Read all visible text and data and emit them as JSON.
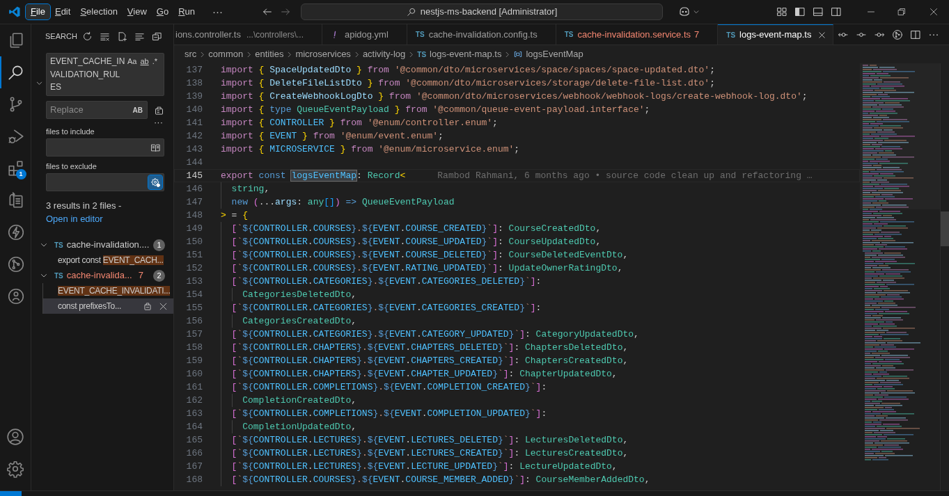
{
  "title_bar": {
    "menu": [
      {
        "label": "File",
        "selected": true
      },
      {
        "label": "Edit",
        "selected": false
      },
      {
        "label": "Selection",
        "selected": false
      },
      {
        "label": "View",
        "selected": false
      },
      {
        "label": "Go",
        "selected": false
      },
      {
        "label": "Run",
        "selected": false
      }
    ],
    "overflow": "···",
    "command_center": "nestjs-ms-backend [Administrator]"
  },
  "activity_bar": {
    "items": [
      {
        "kind": "files",
        "selected": false
      },
      {
        "kind": "search",
        "selected": true
      },
      {
        "kind": "source-control",
        "selected": false
      },
      {
        "kind": "debug",
        "selected": false
      },
      {
        "kind": "extensions",
        "selected": false,
        "badge": "1"
      },
      {
        "kind": "remote",
        "selected": false
      },
      {
        "kind": "lightning",
        "selected": false
      },
      {
        "kind": "git",
        "selected": false
      },
      {
        "kind": "circle",
        "selected": false
      }
    ],
    "bottom": [
      {
        "kind": "account"
      },
      {
        "kind": "settings"
      }
    ]
  },
  "search_panel": {
    "title": "SEARCH",
    "replace_expanded": true,
    "query": {
      "value": "EVENT_CACHE_INVALIDATION_RULES",
      "toggles": [
        {
          "label": "Aa",
          "selected": false
        },
        {
          "label": "ab",
          "selected": false
        },
        {
          "label": ".*",
          "selected": false
        }
      ]
    },
    "replace": {
      "placeholder": "Replace",
      "toggle": {
        "label": "AB",
        "selected": false
      }
    },
    "details_toggle": "···",
    "include": {
      "label": "files to include",
      "selected": false
    },
    "exclude": {
      "label": "files to exclude",
      "selected": true
    },
    "message": "3 results in 2 files - ",
    "link": "Open in editor",
    "results": [
      {
        "icon": "TS",
        "file": "cache-invalidation....",
        "error": false,
        "count": "1",
        "expanded": true,
        "matches": [
          {
            "before": "export const ",
            "match": "EVENT_CACH...",
            "selected": false
          }
        ]
      },
      {
        "icon": "TS",
        "file": "cache-invalida...",
        "error": true,
        "problems": "7",
        "count": "2",
        "expanded": true,
        "matches": [
          {
            "match": "EVENT_CACHE_INVALIDATI...",
            "selected": false
          },
          {
            "before": "const prefixesTo...",
            "selected": true
          }
        ]
      }
    ]
  },
  "tabs": [
    {
      "kind": "plain",
      "label": "ions.controller.ts",
      "description": "...\\controllers\\...",
      "error": false,
      "selected": false
    },
    {
      "kind": "yaml",
      "label": "apidog.yml",
      "error": false,
      "selected": false
    },
    {
      "kind": "ts",
      "icon": "TS",
      "label": "cache-invalidation.config.ts",
      "error": false,
      "selected": false
    },
    {
      "kind": "ts",
      "icon": "TS",
      "label": "cache-invalidation.service.ts",
      "problems": "7",
      "error": true,
      "selected": false
    },
    {
      "kind": "ts",
      "icon": "TS",
      "label": "logs-event-map.ts",
      "error": false,
      "selected": true
    }
  ],
  "breadcrumb": {
    "folders": [
      "src",
      "common",
      "entities",
      "microservices",
      "activity-log"
    ],
    "file": {
      "icon": "TS",
      "label": "logs-event-map.ts"
    },
    "symbol": "logsEventMap"
  },
  "editor": {
    "lines": [
      {
        "number": "137",
        "kind": "top",
        "current": false,
        "tokens": [
          {
            "kind": "keyword",
            "text": "import "
          },
          {
            "kind": "brace",
            "text": "{"
          },
          {
            "kind": "name",
            "text": " SpaceUpdatedDto "
          },
          {
            "kind": "brace",
            "text": "}"
          },
          {
            "kind": "keyword",
            "text": " from "
          },
          {
            "kind": "string",
            "text": "'@common/dto/microservices/space/spaces/space-updated.dto'"
          },
          {
            "kind": "plain",
            "text": ";"
          }
        ]
      },
      {
        "number": "138",
        "kind": "top",
        "current": false,
        "tokens": [
          {
            "kind": "keyword",
            "text": "import "
          },
          {
            "kind": "brace",
            "text": "{"
          },
          {
            "kind": "name",
            "text": " DeleteFileListDto "
          },
          {
            "kind": "brace",
            "text": "}"
          },
          {
            "kind": "keyword",
            "text": " from "
          },
          {
            "kind": "string",
            "text": "'@common/dto/microservices/storage/delete-file-list.dto'"
          },
          {
            "kind": "plain",
            "text": ";"
          }
        ]
      },
      {
        "number": "139",
        "kind": "top",
        "current": false,
        "tokens": [
          {
            "kind": "keyword",
            "text": "import "
          },
          {
            "kind": "brace",
            "text": "{"
          },
          {
            "kind": "name",
            "text": " CreateWebhookLogDto "
          },
          {
            "kind": "brace",
            "text": "}"
          },
          {
            "kind": "keyword",
            "text": " from "
          },
          {
            "kind": "string",
            "text": "'@common/dto/microservices/webhook/webhook-logs/create-webhook-log.dto'"
          },
          {
            "kind": "plain",
            "text": ";"
          }
        ]
      },
      {
        "number": "140",
        "kind": "top",
        "current": false,
        "tokens": [
          {
            "kind": "keyword",
            "text": "import "
          },
          {
            "kind": "brace",
            "text": "{"
          },
          {
            "kind": "storage",
            "text": " type"
          },
          {
            "kind": "type",
            "text": " QueueEventPayload "
          },
          {
            "kind": "brace",
            "text": "}"
          },
          {
            "kind": "keyword",
            "text": " from "
          },
          {
            "kind": "string",
            "text": "'@common/queue-event-payload.interface'"
          },
          {
            "kind": "plain",
            "text": ";"
          }
        ]
      },
      {
        "number": "141",
        "kind": "top",
        "current": false,
        "tokens": [
          {
            "kind": "keyword",
            "text": "import "
          },
          {
            "kind": "brace",
            "text": "{"
          },
          {
            "kind": "constant",
            "text": " CONTROLLER "
          },
          {
            "kind": "brace",
            "text": "}"
          },
          {
            "kind": "keyword",
            "text": " from "
          },
          {
            "kind": "string",
            "text": "'@enum/controller.enum'"
          },
          {
            "kind": "plain",
            "text": ";"
          }
        ]
      },
      {
        "number": "142",
        "kind": "top",
        "current": false,
        "tokens": [
          {
            "kind": "keyword",
            "text": "import "
          },
          {
            "kind": "brace",
            "text": "{"
          },
          {
            "kind": "constant",
            "text": " EVENT "
          },
          {
            "kind": "brace",
            "text": "}"
          },
          {
            "kind": "keyword",
            "text": " from "
          },
          {
            "kind": "string",
            "text": "'@enum/event.enum'"
          },
          {
            "kind": "plain",
            "text": ";"
          }
        ]
      },
      {
        "number": "143",
        "kind": "top",
        "current": false,
        "tokens": [
          {
            "kind": "keyword",
            "text": "import "
          },
          {
            "kind": "brace",
            "text": "{"
          },
          {
            "kind": "constant",
            "text": " MICROSERVICE "
          },
          {
            "kind": "brace",
            "text": "}"
          },
          {
            "kind": "keyword",
            "text": " from "
          },
          {
            "kind": "string",
            "text": "'@enum/microservice.enum'"
          },
          {
            "kind": "plain",
            "text": ";"
          }
        ]
      },
      {
        "number": "144",
        "kind": "top",
        "current": false
      },
      {
        "number": "145",
        "kind": "top",
        "current": true,
        "tokens": [
          {
            "kind": "keyword",
            "text": "export "
          },
          {
            "kind": "storage",
            "text": "const "
          },
          {
            "kind": "symbol",
            "text": "logsEventMap"
          },
          {
            "kind": "plain",
            "text": ": "
          },
          {
            "kind": "type",
            "text": "Record"
          },
          {
            "kind": "brace",
            "text": "<"
          }
        ],
        "blame": "Rambod Rahmani, 6 months ago • source code clean up and refactoring …"
      },
      {
        "number": "146",
        "kind": "member",
        "current": false,
        "tokens": [
          {
            "kind": "type",
            "text": "string"
          },
          {
            "kind": "plain",
            "text": ","
          }
        ]
      },
      {
        "number": "147",
        "kind": "member",
        "current": false,
        "tokens": [
          {
            "kind": "storage",
            "text": "new "
          },
          {
            "kind": "paren",
            "text": "("
          },
          {
            "kind": "plain",
            "text": "..."
          },
          {
            "kind": "name",
            "text": "args"
          },
          {
            "kind": "plain",
            "text": ": "
          },
          {
            "kind": "type",
            "text": "any"
          },
          {
            "kind": "bracket",
            "text": "[]"
          },
          {
            "kind": "paren",
            "text": ")"
          },
          {
            "kind": "storage",
            "text": " =>"
          },
          {
            "kind": "type",
            "text": " QueueEventPayload"
          }
        ]
      },
      {
        "number": "148",
        "kind": "top",
        "current": false,
        "tokens": [
          {
            "kind": "brace",
            "text": ">"
          },
          {
            "kind": "plain",
            "text": " = "
          },
          {
            "kind": "brace",
            "text": "{"
          }
        ]
      },
      {
        "number": "149",
        "kind": "member",
        "current": false,
        "tokens": [
          {
            "kind": "paren",
            "text": "["
          },
          {
            "kind": "string",
            "text": "`"
          },
          {
            "kind": "interp",
            "text": "${"
          },
          {
            "kind": "constant",
            "text": "CONTROLLER"
          },
          {
            "kind": "plain",
            "text": "."
          },
          {
            "kind": "constant",
            "text": "COURSES"
          },
          {
            "kind": "interp",
            "text": "}"
          },
          {
            "kind": "string",
            "text": "."
          },
          {
            "kind": "interp",
            "text": "${"
          },
          {
            "kind": "constant",
            "text": "EVENT"
          },
          {
            "kind": "plain",
            "text": "."
          },
          {
            "kind": "constant",
            "text": "COURSE_CREATED"
          },
          {
            "kind": "interp",
            "text": "}"
          },
          {
            "kind": "string",
            "text": "`"
          },
          {
            "kind": "paren",
            "text": "]"
          },
          {
            "kind": "plain",
            "text": ": "
          },
          {
            "kind": "type",
            "text": "CourseCreatedDto"
          },
          {
            "kind": "plain",
            "text": ","
          }
        ]
      },
      {
        "number": "150",
        "kind": "member",
        "current": false,
        "tokens": [
          {
            "kind": "paren",
            "text": "["
          },
          {
            "kind": "string",
            "text": "`"
          },
          {
            "kind": "interp",
            "text": "${"
          },
          {
            "kind": "constant",
            "text": "CONTROLLER"
          },
          {
            "kind": "plain",
            "text": "."
          },
          {
            "kind": "constant",
            "text": "COURSES"
          },
          {
            "kind": "interp",
            "text": "}"
          },
          {
            "kind": "string",
            "text": "."
          },
          {
            "kind": "interp",
            "text": "${"
          },
          {
            "kind": "constant",
            "text": "EVENT"
          },
          {
            "kind": "plain",
            "text": "."
          },
          {
            "kind": "constant",
            "text": "COURSE_UPDATED"
          },
          {
            "kind": "interp",
            "text": "}"
          },
          {
            "kind": "string",
            "text": "`"
          },
          {
            "kind": "paren",
            "text": "]"
          },
          {
            "kind": "plain",
            "text": ": "
          },
          {
            "kind": "type",
            "text": "CourseUpdatedDto"
          },
          {
            "kind": "plain",
            "text": ","
          }
        ]
      },
      {
        "number": "151",
        "kind": "member",
        "current": false,
        "tokens": [
          {
            "kind": "paren",
            "text": "["
          },
          {
            "kind": "string",
            "text": "`"
          },
          {
            "kind": "interp",
            "text": "${"
          },
          {
            "kind": "constant",
            "text": "CONTROLLER"
          },
          {
            "kind": "plain",
            "text": "."
          },
          {
            "kind": "constant",
            "text": "COURSES"
          },
          {
            "kind": "interp",
            "text": "}"
          },
          {
            "kind": "string",
            "text": "."
          },
          {
            "kind": "interp",
            "text": "${"
          },
          {
            "kind": "constant",
            "text": "EVENT"
          },
          {
            "kind": "plain",
            "text": "."
          },
          {
            "kind": "constant",
            "text": "COURSE_DELETED"
          },
          {
            "kind": "interp",
            "text": "}"
          },
          {
            "kind": "string",
            "text": "`"
          },
          {
            "kind": "paren",
            "text": "]"
          },
          {
            "kind": "plain",
            "text": ": "
          },
          {
            "kind": "type",
            "text": "CourseDeletedEventDto"
          },
          {
            "kind": "plain",
            "text": ","
          }
        ]
      },
      {
        "number": "152",
        "kind": "member",
        "current": false,
        "tokens": [
          {
            "kind": "paren",
            "text": "["
          },
          {
            "kind": "string",
            "text": "`"
          },
          {
            "kind": "interp",
            "text": "${"
          },
          {
            "kind": "constant",
            "text": "CONTROLLER"
          },
          {
            "kind": "plain",
            "text": "."
          },
          {
            "kind": "constant",
            "text": "COURSES"
          },
          {
            "kind": "interp",
            "text": "}"
          },
          {
            "kind": "string",
            "text": "."
          },
          {
            "kind": "interp",
            "text": "${"
          },
          {
            "kind": "constant",
            "text": "EVENT"
          },
          {
            "kind": "plain",
            "text": "."
          },
          {
            "kind": "constant",
            "text": "RATING_UPDATED"
          },
          {
            "kind": "interp",
            "text": "}"
          },
          {
            "kind": "string",
            "text": "`"
          },
          {
            "kind": "paren",
            "text": "]"
          },
          {
            "kind": "plain",
            "text": ": "
          },
          {
            "kind": "type",
            "text": "UpdateOwnerRatingDto"
          },
          {
            "kind": "plain",
            "text": ","
          }
        ]
      },
      {
        "number": "153",
        "kind": "member",
        "current": false,
        "tokens": [
          {
            "kind": "paren",
            "text": "["
          },
          {
            "kind": "string",
            "text": "`"
          },
          {
            "kind": "interp",
            "text": "${"
          },
          {
            "kind": "constant",
            "text": "CONTROLLER"
          },
          {
            "kind": "plain",
            "text": "."
          },
          {
            "kind": "constant",
            "text": "CATEGORIES"
          },
          {
            "kind": "interp",
            "text": "}"
          },
          {
            "kind": "string",
            "text": "."
          },
          {
            "kind": "interp",
            "text": "${"
          },
          {
            "kind": "constant",
            "text": "EVENT"
          },
          {
            "kind": "plain",
            "text": "."
          },
          {
            "kind": "constant",
            "text": "CATEGORIES_DELETED"
          },
          {
            "kind": "interp",
            "text": "}"
          },
          {
            "kind": "string",
            "text": "`"
          },
          {
            "kind": "paren",
            "text": "]"
          },
          {
            "kind": "plain",
            "text": ":"
          }
        ]
      },
      {
        "number": "154",
        "kind": "wrap",
        "current": false,
        "tokens": [
          {
            "kind": "type",
            "text": "CategoriesDeletedDto"
          },
          {
            "kind": "plain",
            "text": ","
          }
        ]
      },
      {
        "number": "155",
        "kind": "member",
        "current": false,
        "tokens": [
          {
            "kind": "paren",
            "text": "["
          },
          {
            "kind": "string",
            "text": "`"
          },
          {
            "kind": "interp",
            "text": "${"
          },
          {
            "kind": "constant",
            "text": "CONTROLLER"
          },
          {
            "kind": "plain",
            "text": "."
          },
          {
            "kind": "constant",
            "text": "CATEGORIES"
          },
          {
            "kind": "interp",
            "text": "}"
          },
          {
            "kind": "string",
            "text": "."
          },
          {
            "kind": "interp",
            "text": "${"
          },
          {
            "kind": "constant",
            "text": "EVENT"
          },
          {
            "kind": "plain",
            "text": "."
          },
          {
            "kind": "constant",
            "text": "CATEGORIES_CREATED"
          },
          {
            "kind": "interp",
            "text": "}"
          },
          {
            "kind": "string",
            "text": "`"
          },
          {
            "kind": "paren",
            "text": "]"
          },
          {
            "kind": "plain",
            "text": ":"
          }
        ]
      },
      {
        "number": "156",
        "kind": "wrap",
        "current": false,
        "tokens": [
          {
            "kind": "type",
            "text": "CategoriesCreatedDto"
          },
          {
            "kind": "plain",
            "text": ","
          }
        ]
      },
      {
        "number": "157",
        "kind": "member",
        "current": false,
        "tokens": [
          {
            "kind": "paren",
            "text": "["
          },
          {
            "kind": "string",
            "text": "`"
          },
          {
            "kind": "interp",
            "text": "${"
          },
          {
            "kind": "constant",
            "text": "CONTROLLER"
          },
          {
            "kind": "plain",
            "text": "."
          },
          {
            "kind": "constant",
            "text": "CATEGORIES"
          },
          {
            "kind": "interp",
            "text": "}"
          },
          {
            "kind": "string",
            "text": "."
          },
          {
            "kind": "interp",
            "text": "${"
          },
          {
            "kind": "constant",
            "text": "EVENT"
          },
          {
            "kind": "plain",
            "text": "."
          },
          {
            "kind": "constant",
            "text": "CATEGORY_UPDATED"
          },
          {
            "kind": "interp",
            "text": "}"
          },
          {
            "kind": "string",
            "text": "`"
          },
          {
            "kind": "paren",
            "text": "]"
          },
          {
            "kind": "plain",
            "text": ": "
          },
          {
            "kind": "type",
            "text": "CategoryUpdatedDto"
          },
          {
            "kind": "plain",
            "text": ","
          }
        ]
      },
      {
        "number": "158",
        "kind": "member",
        "current": false,
        "tokens": [
          {
            "kind": "paren",
            "text": "["
          },
          {
            "kind": "string",
            "text": "`"
          },
          {
            "kind": "interp",
            "text": "${"
          },
          {
            "kind": "constant",
            "text": "CONTROLLER"
          },
          {
            "kind": "plain",
            "text": "."
          },
          {
            "kind": "constant",
            "text": "CHAPTERS"
          },
          {
            "kind": "interp",
            "text": "}"
          },
          {
            "kind": "string",
            "text": "."
          },
          {
            "kind": "interp",
            "text": "${"
          },
          {
            "kind": "constant",
            "text": "EVENT"
          },
          {
            "kind": "plain",
            "text": "."
          },
          {
            "kind": "constant",
            "text": "CHAPTERS_DELETED"
          },
          {
            "kind": "interp",
            "text": "}"
          },
          {
            "kind": "string",
            "text": "`"
          },
          {
            "kind": "paren",
            "text": "]"
          },
          {
            "kind": "plain",
            "text": ": "
          },
          {
            "kind": "type",
            "text": "ChaptersDeletedDto"
          },
          {
            "kind": "plain",
            "text": ","
          }
        ]
      },
      {
        "number": "159",
        "kind": "member",
        "current": false,
        "tokens": [
          {
            "kind": "paren",
            "text": "["
          },
          {
            "kind": "string",
            "text": "`"
          },
          {
            "kind": "interp",
            "text": "${"
          },
          {
            "kind": "constant",
            "text": "CONTROLLER"
          },
          {
            "kind": "plain",
            "text": "."
          },
          {
            "kind": "constant",
            "text": "CHAPTERS"
          },
          {
            "kind": "interp",
            "text": "}"
          },
          {
            "kind": "string",
            "text": "."
          },
          {
            "kind": "interp",
            "text": "${"
          },
          {
            "kind": "constant",
            "text": "EVENT"
          },
          {
            "kind": "plain",
            "text": "."
          },
          {
            "kind": "constant",
            "text": "CHAPTERS_CREATED"
          },
          {
            "kind": "interp",
            "text": "}"
          },
          {
            "kind": "string",
            "text": "`"
          },
          {
            "kind": "paren",
            "text": "]"
          },
          {
            "kind": "plain",
            "text": ": "
          },
          {
            "kind": "type",
            "text": "ChaptersCreatedDto"
          },
          {
            "kind": "plain",
            "text": ","
          }
        ]
      },
      {
        "number": "160",
        "kind": "member",
        "current": false,
        "tokens": [
          {
            "kind": "paren",
            "text": "["
          },
          {
            "kind": "string",
            "text": "`"
          },
          {
            "kind": "interp",
            "text": "${"
          },
          {
            "kind": "constant",
            "text": "CONTROLLER"
          },
          {
            "kind": "plain",
            "text": "."
          },
          {
            "kind": "constant",
            "text": "CHAPTERS"
          },
          {
            "kind": "interp",
            "text": "}"
          },
          {
            "kind": "string",
            "text": "."
          },
          {
            "kind": "interp",
            "text": "${"
          },
          {
            "kind": "constant",
            "text": "EVENT"
          },
          {
            "kind": "plain",
            "text": "."
          },
          {
            "kind": "constant",
            "text": "CHAPTER_UPDATED"
          },
          {
            "kind": "interp",
            "text": "}"
          },
          {
            "kind": "string",
            "text": "`"
          },
          {
            "kind": "paren",
            "text": "]"
          },
          {
            "kind": "plain",
            "text": ": "
          },
          {
            "kind": "type",
            "text": "ChapterUpdatedDto"
          },
          {
            "kind": "plain",
            "text": ","
          }
        ]
      },
      {
        "number": "161",
        "kind": "member",
        "current": false,
        "tokens": [
          {
            "kind": "paren",
            "text": "["
          },
          {
            "kind": "string",
            "text": "`"
          },
          {
            "kind": "interp",
            "text": "${"
          },
          {
            "kind": "constant",
            "text": "CONTROLLER"
          },
          {
            "kind": "plain",
            "text": "."
          },
          {
            "kind": "constant",
            "text": "COMPLETIONS"
          },
          {
            "kind": "interp",
            "text": "}"
          },
          {
            "kind": "string",
            "text": "."
          },
          {
            "kind": "interp",
            "text": "${"
          },
          {
            "kind": "constant",
            "text": "EVENT"
          },
          {
            "kind": "plain",
            "text": "."
          },
          {
            "kind": "constant",
            "text": "COMPLETION_CREATED"
          },
          {
            "kind": "interp",
            "text": "}"
          },
          {
            "kind": "string",
            "text": "`"
          },
          {
            "kind": "paren",
            "text": "]"
          },
          {
            "kind": "plain",
            "text": ":"
          }
        ]
      },
      {
        "number": "162",
        "kind": "wrap",
        "current": false,
        "tokens": [
          {
            "kind": "type",
            "text": "CompletionCreatedDto"
          },
          {
            "kind": "plain",
            "text": ","
          }
        ]
      },
      {
        "number": "163",
        "kind": "member",
        "current": false,
        "tokens": [
          {
            "kind": "paren",
            "text": "["
          },
          {
            "kind": "string",
            "text": "`"
          },
          {
            "kind": "interp",
            "text": "${"
          },
          {
            "kind": "constant",
            "text": "CONTROLLER"
          },
          {
            "kind": "plain",
            "text": "."
          },
          {
            "kind": "constant",
            "text": "COMPLETIONS"
          },
          {
            "kind": "interp",
            "text": "}"
          },
          {
            "kind": "string",
            "text": "."
          },
          {
            "kind": "interp",
            "text": "${"
          },
          {
            "kind": "constant",
            "text": "EVENT"
          },
          {
            "kind": "plain",
            "text": "."
          },
          {
            "kind": "constant",
            "text": "COMPLETION_UPDATED"
          },
          {
            "kind": "interp",
            "text": "}"
          },
          {
            "kind": "string",
            "text": "`"
          },
          {
            "kind": "paren",
            "text": "]"
          },
          {
            "kind": "plain",
            "text": ":"
          }
        ]
      },
      {
        "number": "164",
        "kind": "wrap",
        "current": false,
        "tokens": [
          {
            "kind": "type",
            "text": "CompletionUpdatedDto"
          },
          {
            "kind": "plain",
            "text": ","
          }
        ]
      },
      {
        "number": "165",
        "kind": "member",
        "current": false,
        "tokens": [
          {
            "kind": "paren",
            "text": "["
          },
          {
            "kind": "string",
            "text": "`"
          },
          {
            "kind": "interp",
            "text": "${"
          },
          {
            "kind": "constant",
            "text": "CONTROLLER"
          },
          {
            "kind": "plain",
            "text": "."
          },
          {
            "kind": "constant",
            "text": "LECTURES"
          },
          {
            "kind": "interp",
            "text": "}"
          },
          {
            "kind": "string",
            "text": "."
          },
          {
            "kind": "interp",
            "text": "${"
          },
          {
            "kind": "constant",
            "text": "EVENT"
          },
          {
            "kind": "plain",
            "text": "."
          },
          {
            "kind": "constant",
            "text": "LECTURES_DELETED"
          },
          {
            "kind": "interp",
            "text": "}"
          },
          {
            "kind": "string",
            "text": "`"
          },
          {
            "kind": "paren",
            "text": "]"
          },
          {
            "kind": "plain",
            "text": ": "
          },
          {
            "kind": "type",
            "text": "LecturesDeletedDto"
          },
          {
            "kind": "plain",
            "text": ","
          }
        ]
      },
      {
        "number": "166",
        "kind": "member",
        "current": false,
        "tokens": [
          {
            "kind": "paren",
            "text": "["
          },
          {
            "kind": "string",
            "text": "`"
          },
          {
            "kind": "interp",
            "text": "${"
          },
          {
            "kind": "constant",
            "text": "CONTROLLER"
          },
          {
            "kind": "plain",
            "text": "."
          },
          {
            "kind": "constant",
            "text": "LECTURES"
          },
          {
            "kind": "interp",
            "text": "}"
          },
          {
            "kind": "string",
            "text": "."
          },
          {
            "kind": "interp",
            "text": "${"
          },
          {
            "kind": "constant",
            "text": "EVENT"
          },
          {
            "kind": "plain",
            "text": "."
          },
          {
            "kind": "constant",
            "text": "LECTURES_CREATED"
          },
          {
            "kind": "interp",
            "text": "}"
          },
          {
            "kind": "string",
            "text": "`"
          },
          {
            "kind": "paren",
            "text": "]"
          },
          {
            "kind": "plain",
            "text": ": "
          },
          {
            "kind": "type",
            "text": "LecturesCreatedDto"
          },
          {
            "kind": "plain",
            "text": ","
          }
        ]
      },
      {
        "number": "167",
        "kind": "member",
        "current": false,
        "tokens": [
          {
            "kind": "paren",
            "text": "["
          },
          {
            "kind": "string",
            "text": "`"
          },
          {
            "kind": "interp",
            "text": "${"
          },
          {
            "kind": "constant",
            "text": "CONTROLLER"
          },
          {
            "kind": "plain",
            "text": "."
          },
          {
            "kind": "constant",
            "text": "LECTURES"
          },
          {
            "kind": "interp",
            "text": "}"
          },
          {
            "kind": "string",
            "text": "."
          },
          {
            "kind": "interp",
            "text": "${"
          },
          {
            "kind": "constant",
            "text": "EVENT"
          },
          {
            "kind": "plain",
            "text": "."
          },
          {
            "kind": "constant",
            "text": "LECTURE_UPDATED"
          },
          {
            "kind": "interp",
            "text": "}"
          },
          {
            "kind": "string",
            "text": "`"
          },
          {
            "kind": "paren",
            "text": "]"
          },
          {
            "kind": "plain",
            "text": ": "
          },
          {
            "kind": "type",
            "text": "LectureUpdatedDto"
          },
          {
            "kind": "plain",
            "text": ","
          }
        ]
      },
      {
        "number": "168",
        "kind": "member",
        "current": false,
        "tokens": [
          {
            "kind": "paren",
            "text": "["
          },
          {
            "kind": "string",
            "text": "`"
          },
          {
            "kind": "interp",
            "text": "${"
          },
          {
            "kind": "constant",
            "text": "CONTROLLER"
          },
          {
            "kind": "plain",
            "text": "."
          },
          {
            "kind": "constant",
            "text": "COURSES"
          },
          {
            "kind": "interp",
            "text": "}"
          },
          {
            "kind": "string",
            "text": "."
          },
          {
            "kind": "interp",
            "text": "${"
          },
          {
            "kind": "constant",
            "text": "EVENT"
          },
          {
            "kind": "plain",
            "text": "."
          },
          {
            "kind": "constant",
            "text": "COURSE_MEMBER_ADDED"
          },
          {
            "kind": "interp",
            "text": "}"
          },
          {
            "kind": "string",
            "text": "`"
          },
          {
            "kind": "paren",
            "text": "]"
          },
          {
            "kind": "plain",
            "text": ": "
          },
          {
            "kind": "type",
            "text": "CourseMemberAddedDto"
          },
          {
            "kind": "plain",
            "text": ","
          }
        ]
      }
    ]
  }
}
